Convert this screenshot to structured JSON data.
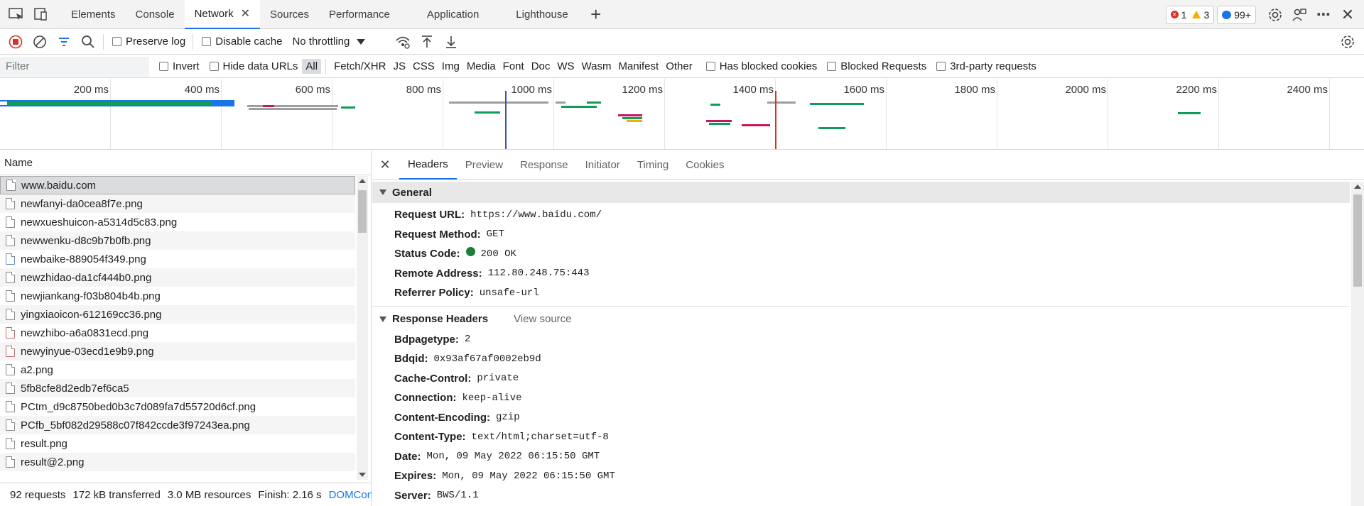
{
  "tabs": [
    {
      "label": "Elements"
    },
    {
      "label": "Console"
    },
    {
      "label": "Network",
      "active": true
    },
    {
      "label": "Sources"
    },
    {
      "label": "Performance"
    },
    {
      "label": "Application"
    },
    {
      "label": "Lighthouse"
    }
  ],
  "badges": {
    "errors": "1",
    "warnings": "3",
    "messages": "99+"
  },
  "toolbar": {
    "preserve_log": "Preserve log",
    "disable_cache": "Disable cache",
    "throttling": "No throttling"
  },
  "filter": {
    "placeholder": "Filter",
    "invert": "Invert",
    "hide_data_urls": "Hide data URLs",
    "types": [
      "All",
      "Fetch/XHR",
      "JS",
      "CSS",
      "Img",
      "Media",
      "Font",
      "Doc",
      "WS",
      "Wasm",
      "Manifest",
      "Other"
    ],
    "has_blocked_cookies": "Has blocked cookies",
    "blocked_requests": "Blocked Requests",
    "third_party": "3rd-party requests"
  },
  "overview": {
    "ticks": [
      "200 ms",
      "400 ms",
      "600 ms",
      "800 ms",
      "1000 ms",
      "1200 ms",
      "1400 ms",
      "1600 ms",
      "1800 ms",
      "2000 ms",
      "2200 ms",
      "2400 ms"
    ]
  },
  "requests": {
    "header": "Name",
    "rows": [
      {
        "name": "www.baidu.com"
      },
      {
        "name": "newfanyi-da0cea8f7e.png"
      },
      {
        "name": "newxueshuicon-a5314d5c83.png"
      },
      {
        "name": "newwenku-d8c9b7b0fb.png"
      },
      {
        "name": "newbaike-889054f349.png"
      },
      {
        "name": "newzhidao-da1cf444b0.png"
      },
      {
        "name": "newjiankang-f03b804b4b.png"
      },
      {
        "name": "yingxiaoicon-612169cc36.png"
      },
      {
        "name": "newzhibo-a6a0831ecd.png"
      },
      {
        "name": "newyinyue-03ecd1e9b9.png"
      },
      {
        "name": "a2.png"
      },
      {
        "name": "5fb8cfe8d2edb7ef6ca5"
      },
      {
        "name": "PCtm_d9c8750bed0b3c7d089fa7d55720d6cf.png"
      },
      {
        "name": "PCfb_5bf082d29588c07f842ccde3f97243ea.png"
      },
      {
        "name": "result.png"
      },
      {
        "name": "result@2.png"
      }
    ]
  },
  "status": {
    "requests": "92 requests",
    "transferred": "172 kB transferred",
    "resources": "3.0 MB resources",
    "finish": "Finish: 2.16 s",
    "dom": "DOMContentLoaded"
  },
  "detail": {
    "tabs": [
      "Headers",
      "Preview",
      "Response",
      "Initiator",
      "Timing",
      "Cookies"
    ],
    "general_title": "General",
    "general": [
      {
        "k": "Request URL:",
        "v": "https://www.baidu.com/"
      },
      {
        "k": "Request Method:",
        "v": "GET"
      },
      {
        "k": "Status Code:",
        "v": "200 OK"
      },
      {
        "k": "Remote Address:",
        "v": "112.80.248.75:443"
      },
      {
        "k": "Referrer Policy:",
        "v": "unsafe-url"
      }
    ],
    "response_title": "Response Headers",
    "view_source": "View source",
    "response": [
      {
        "k": "Bdpagetype:",
        "v": "2"
      },
      {
        "k": "Bdqid:",
        "v": "0x93af67af0002eb9d"
      },
      {
        "k": "Cache-Control:",
        "v": "private"
      },
      {
        "k": "Connection:",
        "v": "keep-alive"
      },
      {
        "k": "Content-Encoding:",
        "v": "gzip"
      },
      {
        "k": "Content-Type:",
        "v": "text/html;charset=utf-8"
      },
      {
        "k": "Date:",
        "v": "Mon, 09 May 2022 06:15:50 GMT"
      },
      {
        "k": "Expires:",
        "v": "Mon, 09 May 2022 06:15:50 GMT"
      },
      {
        "k": "Server:",
        "v": "BWS/1.1"
      }
    ]
  },
  "colors": {
    "accent": "#1a73e8",
    "record": "#d93025",
    "bar_green": "#0f9d58",
    "bar_blue": "#1a73e8"
  }
}
